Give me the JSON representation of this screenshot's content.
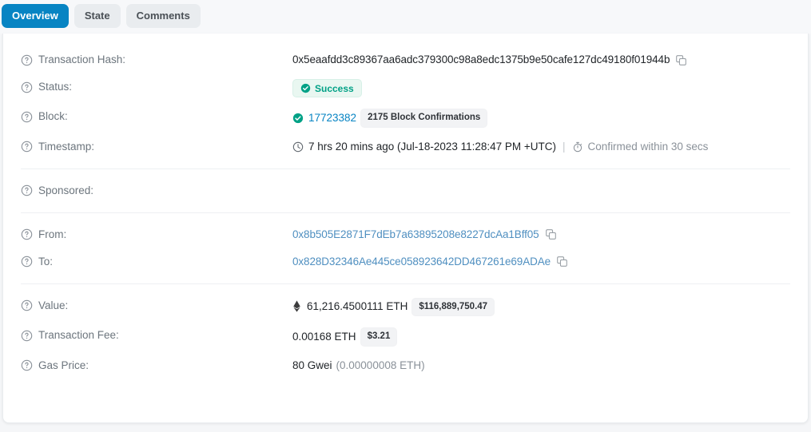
{
  "tabs": [
    {
      "label": "Overview",
      "active": true
    },
    {
      "label": "State",
      "active": false
    },
    {
      "label": "Comments",
      "active": false
    }
  ],
  "fields": {
    "transaction_hash": {
      "label": "Transaction Hash:",
      "value": "0x5eaafdd3c89367aa6adc379300c98a8edc1375b9e50cafe127dc49180f01944b"
    },
    "status": {
      "label": "Status:",
      "value": "Success"
    },
    "block": {
      "label": "Block:",
      "number": "17723382",
      "confirmations": "2175 Block Confirmations"
    },
    "timestamp": {
      "label": "Timestamp:",
      "relative": "7 hrs 20 mins ago (Jul-18-2023 11:28:47 PM +UTC)",
      "separator": "|",
      "confirmed": "Confirmed within 30 secs"
    },
    "sponsored": {
      "label": "Sponsored:",
      "value": ""
    },
    "from": {
      "label": "From:",
      "value": "0x8b505E2871F7dEb7a63895208e8227dcAa1Bff05"
    },
    "to": {
      "label": "To:",
      "value": "0x828D32346Ae445ce058923642DD467261e69ADAe"
    },
    "value": {
      "label": "Value:",
      "eth": "61,216.4500111 ETH",
      "usd": "$116,889,750.47"
    },
    "transaction_fee": {
      "label": "Transaction Fee:",
      "eth": "0.00168 ETH",
      "usd": "$3.21"
    },
    "gas_price": {
      "label": "Gas Price:",
      "gwei": "80 Gwei",
      "eth": "(0.00000008 ETH)"
    }
  },
  "colors": {
    "accent": "#0784c3",
    "success": "#00a186",
    "link": "#4f8fc0",
    "label": "#6c757d",
    "badge_bg": "#f2f3f5"
  },
  "icons": {
    "help": "help-circle-icon",
    "copy": "copy-icon",
    "clock": "clock-icon",
    "stopwatch": "stopwatch-icon",
    "check": "check-circle-icon",
    "eth": "ethereum-diamond-icon"
  }
}
